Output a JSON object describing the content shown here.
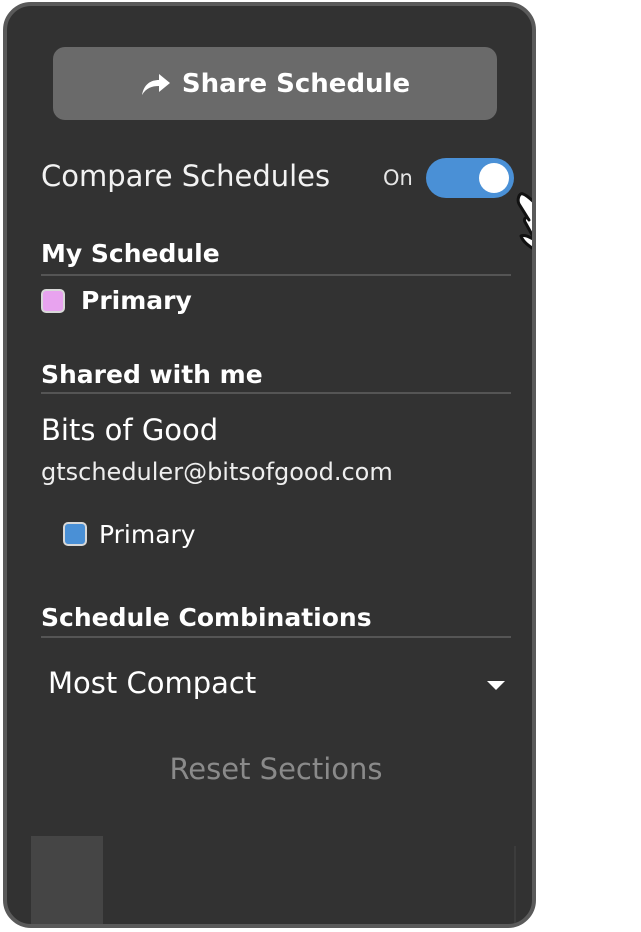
{
  "share": {
    "label": "Share Schedule",
    "icon": "share-arrow-icon"
  },
  "compare": {
    "label": "Compare Schedules",
    "toggle_state_text": "On",
    "toggle_on": true,
    "toggle_color": "#4a90d6"
  },
  "my_schedule": {
    "heading": "My Schedule",
    "items": [
      {
        "label": "Primary",
        "color": "#e8a3ef"
      }
    ]
  },
  "shared_with_me": {
    "heading": "Shared with me",
    "users": [
      {
        "name": "Bits of Good",
        "email": "gtscheduler@bitsofgood.com",
        "schedules": [
          {
            "label": "Primary",
            "color": "#4a90d6"
          }
        ]
      }
    ]
  },
  "combinations": {
    "heading": "Schedule Combinations",
    "selected": "Most Compact"
  },
  "reset": {
    "label": "Reset Sections"
  },
  "colors": {
    "panel_bg": "#323232",
    "panel_border": "#5a5a5a",
    "button_bg": "#6a6a6a",
    "disabled_text": "#8a8a8a"
  }
}
